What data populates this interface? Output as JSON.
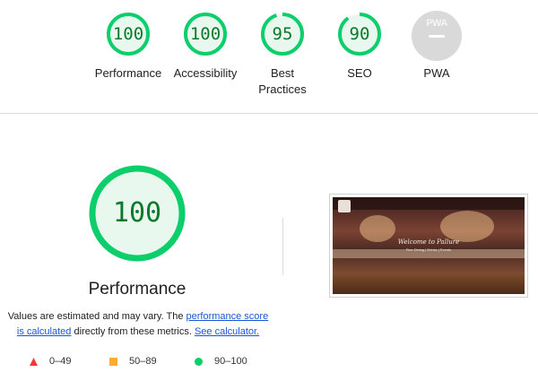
{
  "categories": [
    {
      "label": "Performance",
      "score": 100,
      "status": "pass"
    },
    {
      "label": "Accessibility",
      "score": 100,
      "status": "pass"
    },
    {
      "label": "Best\nPractices",
      "score": 95,
      "status": "pass"
    },
    {
      "label": "SEO",
      "score": 90,
      "status": "pass"
    },
    {
      "label": "PWA",
      "score": null,
      "status": "na"
    }
  ],
  "pwa_badge_text": "PWA",
  "main": {
    "score": 100,
    "title": "Performance",
    "description_prefix": "Values are estimated and may vary. The ",
    "link1": "performance score is calculated",
    "description_mid": " directly from these metrics. ",
    "link2": "See calculator."
  },
  "legend": [
    {
      "range": "0–49",
      "color": "#ff3333",
      "shape": "triangle"
    },
    {
      "range": "50–89",
      "color": "#ffaa33",
      "shape": "square"
    },
    {
      "range": "90–100",
      "color": "#0cce6b",
      "shape": "circle"
    }
  ],
  "screenshot": {
    "heading": "Welcome to Pallure",
    "subheading": "Fine Dining | Drinks | Events"
  },
  "colors": {
    "pass": "#0cce6b",
    "pass_fill": "#e8f8ee",
    "pass_text": "#0a7a2a"
  }
}
